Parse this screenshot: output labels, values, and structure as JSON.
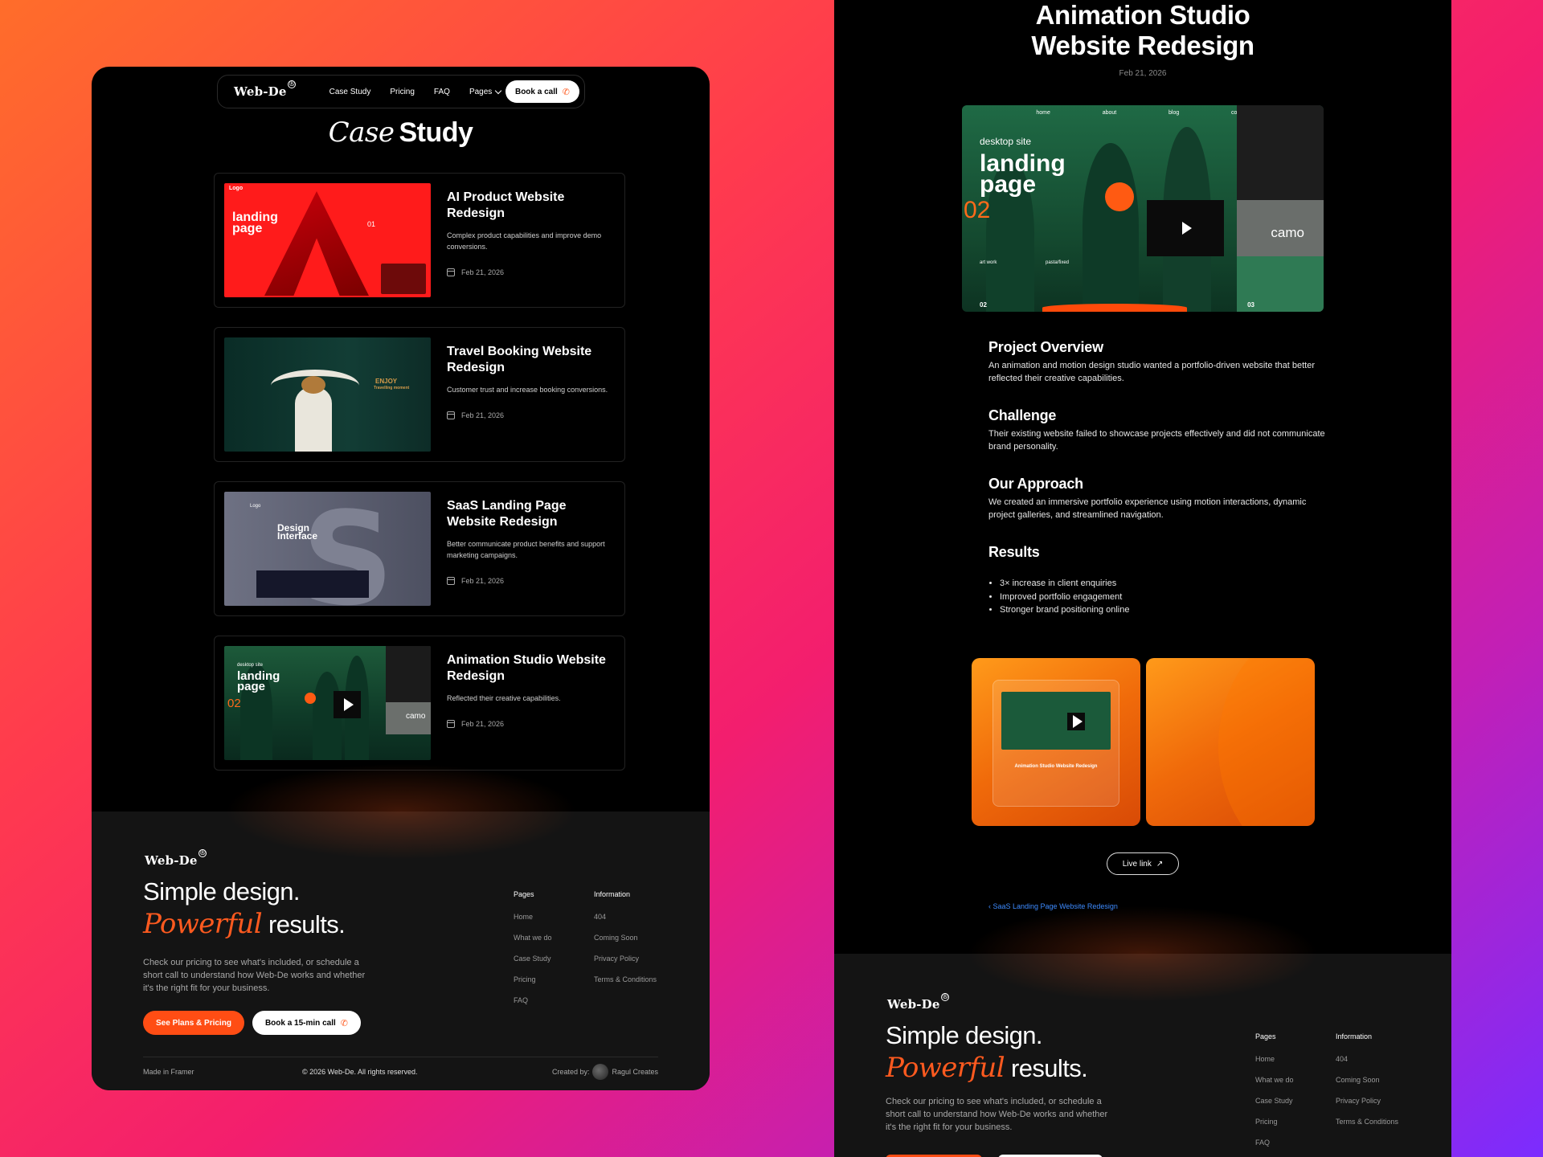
{
  "brand": {
    "name": "Web-De",
    "reg": "®",
    "accent": "#ff5a1f"
  },
  "nav": {
    "links": [
      "Case Study",
      "Pricing",
      "FAQ",
      "Pages"
    ],
    "cta": "Book a call"
  },
  "case_study": {
    "title_italic": "Case",
    "title_bold": "Study",
    "items": [
      {
        "title": "AI Product Website Redesign",
        "desc": "Complex product capabilities and improve demo conversions.",
        "date": "Feb 21, 2026",
        "thumb_text": "landing page",
        "thumb_logo": "Logo",
        "thumb_num": "01"
      },
      {
        "title": "Travel Booking Website Redesign",
        "desc": "Customer trust and increase booking conversions.",
        "date": "Feb 21, 2026",
        "thumb_text": "ENJOY",
        "thumb_sub": "Travelling moment"
      },
      {
        "title": "SaaS Landing Page Website Redesign",
        "desc": "Better communicate product benefits and support marketing campaigns.",
        "date": "Feb 21, 2026",
        "thumb_text": "Design Interface",
        "thumb_logo": "Logo"
      },
      {
        "title": "Animation Studio Website Redesign",
        "desc": "Reflected their creative capabilities.",
        "date": "Feb 21, 2026",
        "thumb_text": "landing page",
        "thumb_small": "desktop site",
        "thumb_num": "02",
        "thumb_camo": "camo"
      }
    ]
  },
  "footer": {
    "headline_1": "Simple design.",
    "headline_italic": "Powerful",
    "headline_2": "results.",
    "text": "Check our pricing to see what's included, or schedule a short call to understand how Web-De works and whether it's the right fit for your business.",
    "btn_primary": "See Plans & Pricing",
    "btn_secondary": "Book a 15-min call",
    "pages_title": "Pages",
    "pages": [
      "Home",
      "What we do",
      "Case Study",
      "Pricing",
      "FAQ"
    ],
    "info_title": "Information",
    "info": [
      "404",
      "Coming Soon",
      "Privacy Policy",
      "Terms & Conditions"
    ],
    "made_in": "Made in Framer",
    "copyright": "© 2026 Web-De. All rights reserved.",
    "created_by": "Created by:",
    "creator": "Ragul Creates"
  },
  "detail": {
    "title": "Animation Studio Website Redesign",
    "date": "Feb 21, 2026",
    "hero": {
      "menu": [
        "home",
        "about",
        "blog",
        "contact"
      ],
      "small": "desktop site",
      "big": "landing page",
      "num": "02",
      "camo": "camo",
      "art": "art work",
      "pasta": "pasta/fixed",
      "pager_left": "02",
      "pager_right": "03"
    },
    "sections": [
      {
        "h": "Project Overview",
        "p": "An animation and motion design studio wanted a portfolio-driven website that better reflected their creative capabilities."
      },
      {
        "h": "Challenge",
        "p": "Their existing website failed to showcase projects effectively and did not communicate brand personality."
      },
      {
        "h": "Our Approach",
        "p": "We created an immersive portfolio experience using motion interactions, dynamic project galleries, and streamlined navigation."
      }
    ],
    "results_title": "Results",
    "results": [
      "3× increase in client enquiries",
      "Improved portfolio engagement",
      "Stronger brand positioning online"
    ],
    "tile_caption": "Animation Studio Website Redesign",
    "live_link": "Live link",
    "prev_link": "‹ SaaS Landing Page Website Redesign"
  }
}
